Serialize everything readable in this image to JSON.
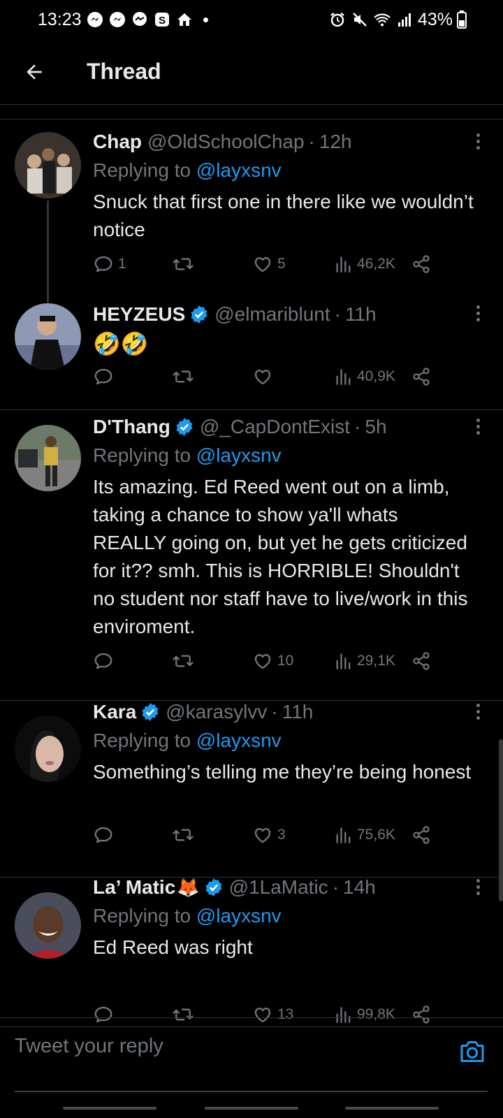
{
  "status_bar": {
    "time": "13:23",
    "battery": "43%",
    "icons_left": [
      "messenger-icon",
      "messenger-icon",
      "chat-icon",
      "s-app-icon",
      "home-icon"
    ],
    "icons_right": [
      "alarm-icon",
      "mute-icon",
      "wifi-icon",
      "signal-icon",
      "battery-icon"
    ]
  },
  "header": {
    "title": "Thread"
  },
  "tweets": [
    {
      "name": "Chap",
      "handle": "@OldSchoolChap",
      "time": "12h",
      "verified": false,
      "reply_label": "Replying to",
      "reply_handle": "@layxsnv",
      "text": "Snuck that first one in there like we wouldn’t notice",
      "replies": "1",
      "retweets": "",
      "likes": "5",
      "views": "46,2K"
    },
    {
      "name": "HEYZEUS",
      "handle": "@elmariblunt",
      "time": "11h",
      "verified": true,
      "text": "🤣🤣",
      "replies": "",
      "retweets": "",
      "likes": "",
      "views": "40,9K"
    },
    {
      "name": "D'Thang",
      "handle": "@_CapDontExist",
      "time": "5h",
      "verified": true,
      "reply_label": "Replying to",
      "reply_handle": "@layxsnv",
      "text": "Its amazing. Ed Reed went out on a limb, taking a chance to show ya'll whats REALLY going on, but yet he gets criticized for it?? smh. This is HORRIBLE! Shouldn't no student nor staff have to live/work in this enviroment.",
      "replies": "",
      "retweets": "",
      "likes": "10",
      "views": "29,1K"
    },
    {
      "name": "Kara",
      "handle": "@karasylvv",
      "time": "11h",
      "verified": true,
      "reply_label": "Replying to",
      "reply_handle": "@layxsnv",
      "text": "Something’s telling me they’re being honest",
      "replies": "",
      "retweets": "",
      "likes": "3",
      "views": "75,6K"
    },
    {
      "name": "La’ Matic",
      "name_emoji": "🦊",
      "handle": "@1LaMatic",
      "time": "14h",
      "verified": true,
      "reply_label": "Replying to",
      "reply_handle": "@layxsnv",
      "text": "Ed Reed was right",
      "replies": "",
      "retweets": "",
      "likes": "13",
      "views": "99,8K"
    }
  ],
  "reply_bar": {
    "placeholder": "Tweet your reply"
  },
  "colors": {
    "background": "#000000",
    "accent": "#1d9bf0",
    "muted": "#71767b",
    "text": "#e7e9ea",
    "divider": "#2f3336"
  }
}
